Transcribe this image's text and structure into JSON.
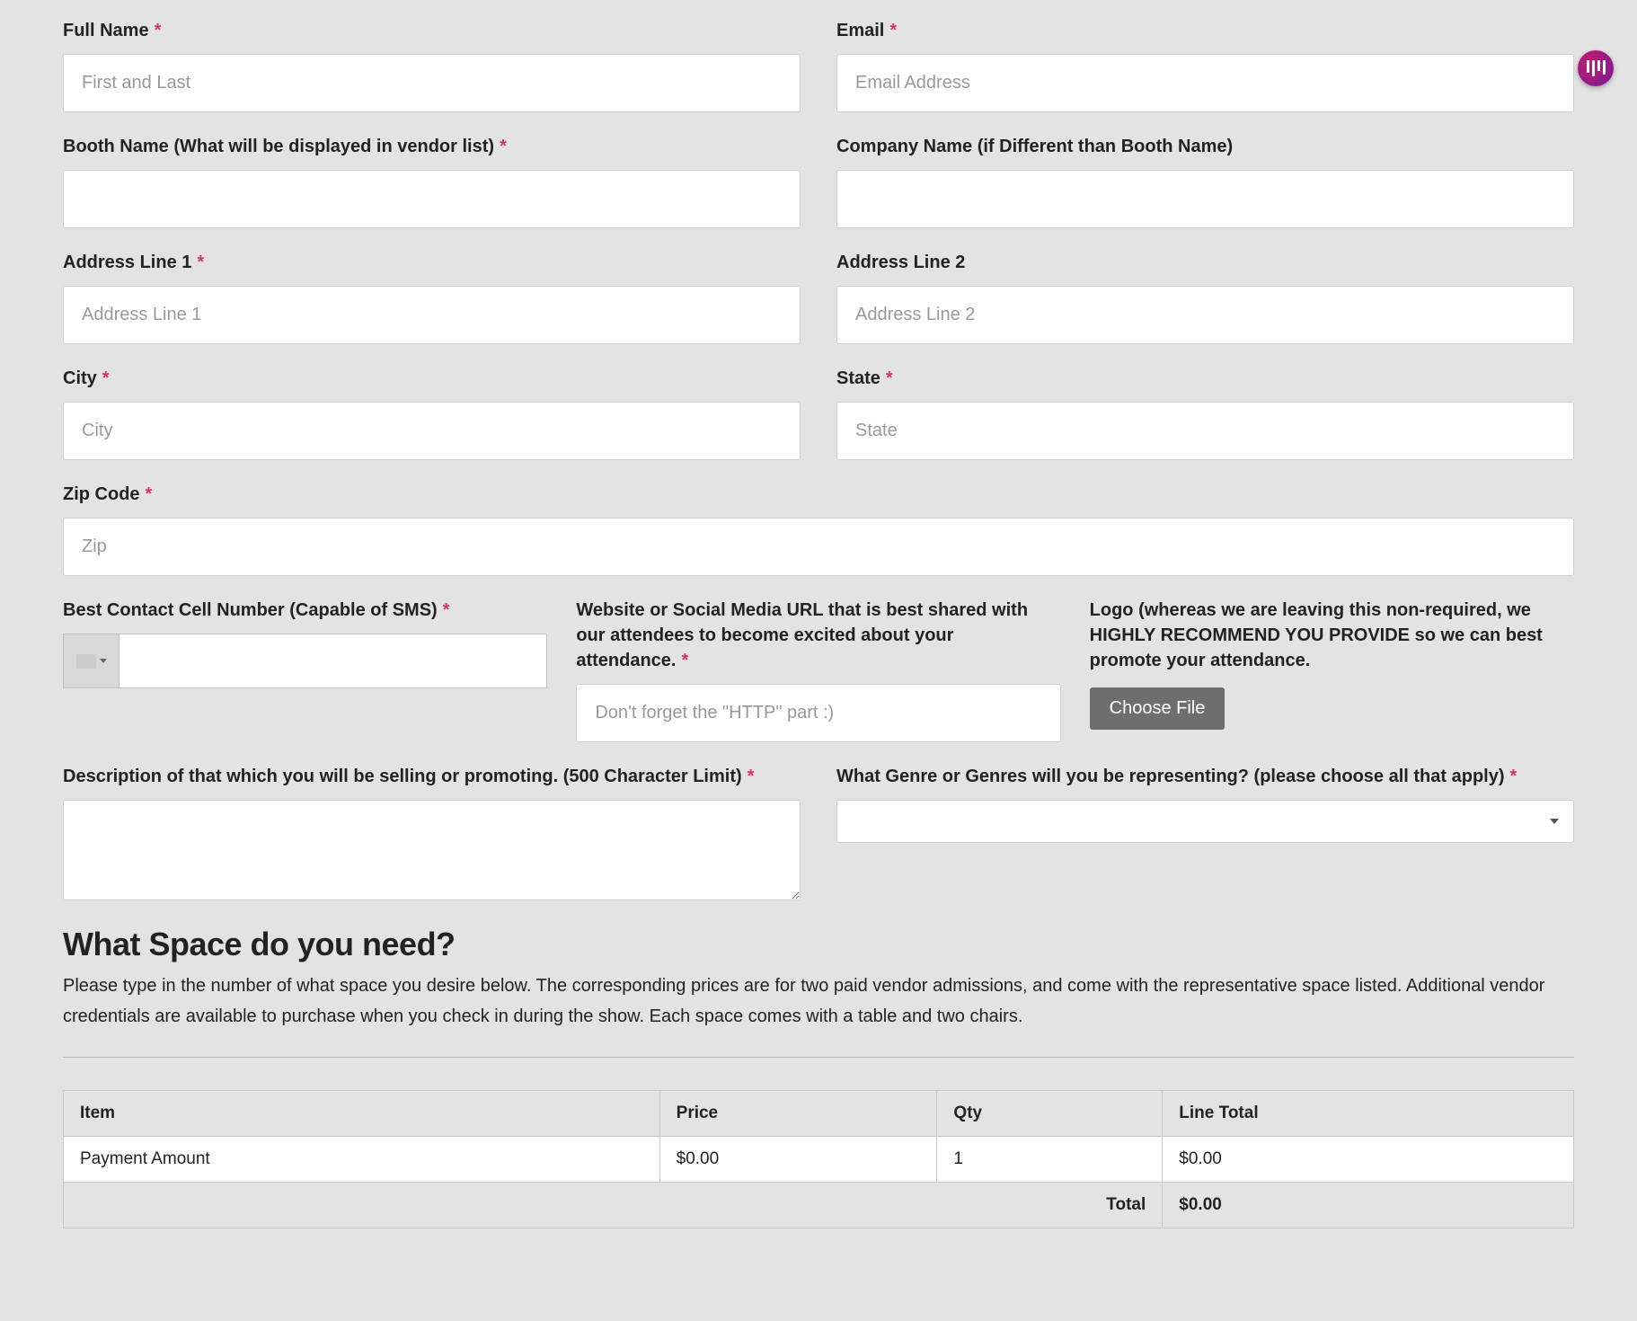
{
  "fields": {
    "full_name": {
      "label": "Full Name",
      "required": true,
      "placeholder": "First and Last"
    },
    "email": {
      "label": "Email",
      "required": true,
      "placeholder": "Email Address"
    },
    "booth_name": {
      "label": "Booth Name (What will be displayed in vendor list)",
      "required": true,
      "placeholder": ""
    },
    "company_name": {
      "label": "Company Name (if Different than Booth Name)",
      "required": false,
      "placeholder": ""
    },
    "address1": {
      "label": "Address Line 1",
      "required": true,
      "placeholder": "Address Line 1"
    },
    "address2": {
      "label": "Address Line 2",
      "required": false,
      "placeholder": "Address Line 2"
    },
    "city": {
      "label": "City",
      "required": true,
      "placeholder": "City"
    },
    "state": {
      "label": "State",
      "required": true,
      "placeholder": "State"
    },
    "zip": {
      "label": "Zip Code",
      "required": true,
      "placeholder": "Zip"
    },
    "phone": {
      "label": "Best Contact Cell Number (Capable of SMS)",
      "required": true,
      "placeholder": ""
    },
    "website": {
      "label": "Website or Social Media URL that is best shared with our attendees to become excited about your attendance.",
      "required": true,
      "placeholder": "Don't forget the \"HTTP\" part :)"
    },
    "logo": {
      "label": "Logo (whereas we are leaving this non-required, we HIGHLY RECOMMEND YOU PROVIDE so we can best promote your attendance.",
      "required": false,
      "button_label": "Choose File"
    },
    "description": {
      "label": "Description of that which you will be selling or promoting. (500 Character Limit)",
      "required": true,
      "placeholder": ""
    },
    "genre": {
      "label": "What Genre or Genres will you be representing? (please choose all that apply)",
      "required": true
    }
  },
  "space_section": {
    "title": "What Space do you need?",
    "description": "Please type in the number of what space you desire below. The corresponding prices are for two paid vendor admissions, and come with the representative space listed. Additional vendor credentials are available to purchase when you check in during the show. Each space comes with a table and two chairs."
  },
  "table": {
    "headers": {
      "item": "Item",
      "price": "Price",
      "qty": "Qty",
      "line_total": "Line Total"
    },
    "rows": [
      {
        "item": "Payment Amount",
        "price": "$0.00",
        "qty": "1",
        "line_total": "$0.00"
      }
    ],
    "total_label": "Total",
    "total_value": "$0.00"
  },
  "required_marker": "*"
}
